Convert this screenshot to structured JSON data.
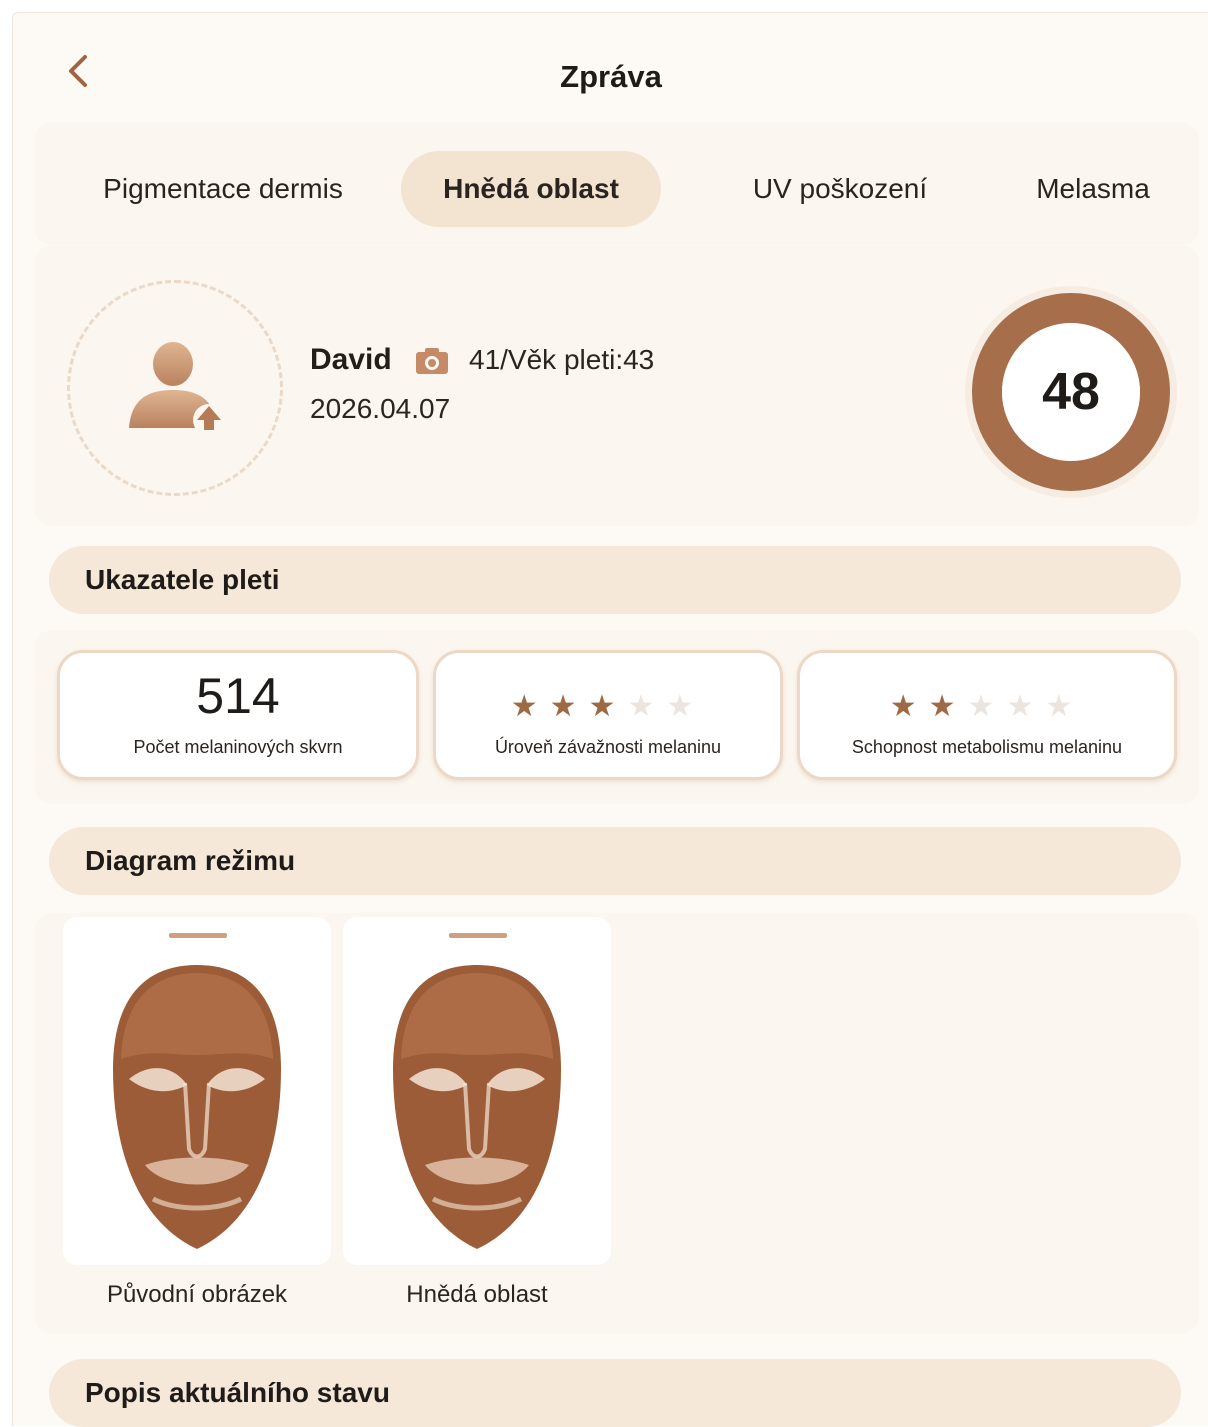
{
  "header": {
    "title": "Zpráva",
    "back_icon": "chevron-left-icon"
  },
  "tabs": [
    {
      "label": "Pigmentace dermis",
      "active": false
    },
    {
      "label": "Hnědá oblast",
      "active": true
    },
    {
      "label": "UV poškození",
      "active": false
    },
    {
      "label": "Melasma",
      "active": false
    }
  ],
  "profile": {
    "name": "David",
    "age_text": "41/Věk pleti:43",
    "date": "2026.04.07",
    "score": "48",
    "avatar_icon": "user-upload-icon",
    "camera_icon": "camera-icon"
  },
  "sections": {
    "indicators": "Ukazatele pleti",
    "diagram": "Diagram režimu",
    "description": "Popis aktuálního stavu"
  },
  "metrics": [
    {
      "value": "514",
      "label": "Počet melaninových skvrn"
    },
    {
      "rating": 3,
      "max": 5,
      "label": "Úroveň závažnosti melaninu"
    },
    {
      "rating": 2,
      "max": 5,
      "label": "Schopnost metabolismu melaninu"
    }
  ],
  "images": [
    {
      "label": "Původní obrázek"
    },
    {
      "label": "Hnědá oblast"
    }
  ],
  "colors": {
    "accent": "#a66e4b",
    "tab_active": "#f3e3d1",
    "section_bar": "#f5e8d9"
  }
}
